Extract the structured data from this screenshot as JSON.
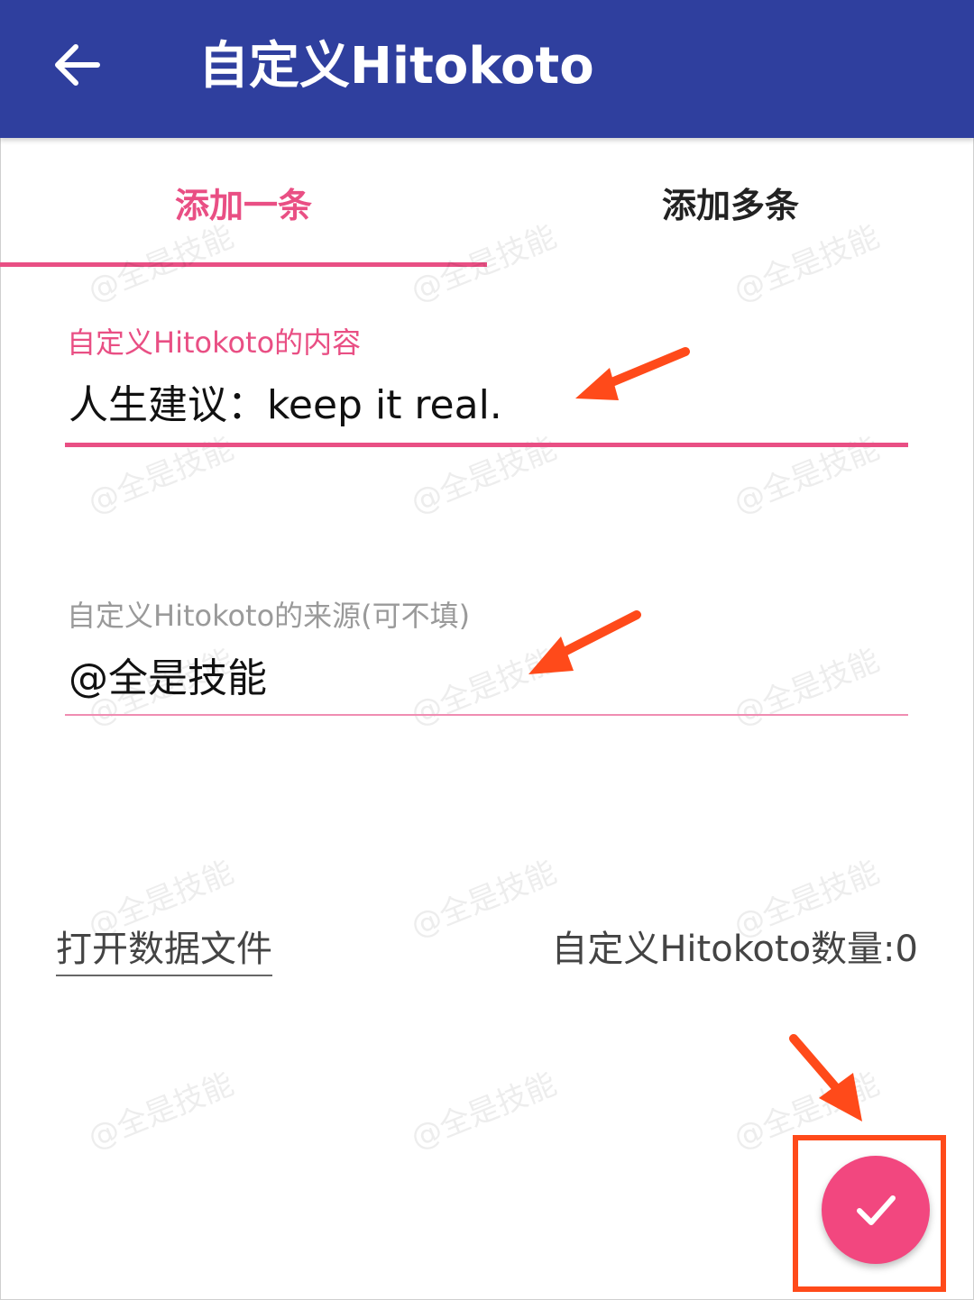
{
  "theme": {
    "primary": "#2f3f9e",
    "accent": "#e94f84",
    "fab": "#f2477f",
    "annotation": "#ff4a1a"
  },
  "appbar": {
    "title": "自定义Hitokoto",
    "back_icon": "arrow-left-icon"
  },
  "tabs": [
    {
      "label": "添加一条",
      "active": true
    },
    {
      "label": "添加多条",
      "active": false
    }
  ],
  "form": {
    "content_label": "自定义Hitokoto的内容",
    "content_value": "人生建议：keep it real.",
    "source_label": "自定义Hitokoto的来源(可不填)",
    "source_value": "@全是技能"
  },
  "footer": {
    "open_file": "打开数据文件",
    "count_label": "自定义Hitokoto数量:",
    "count_value": "0"
  },
  "fab": {
    "icon": "check-icon"
  },
  "watermark": "@全是技能"
}
